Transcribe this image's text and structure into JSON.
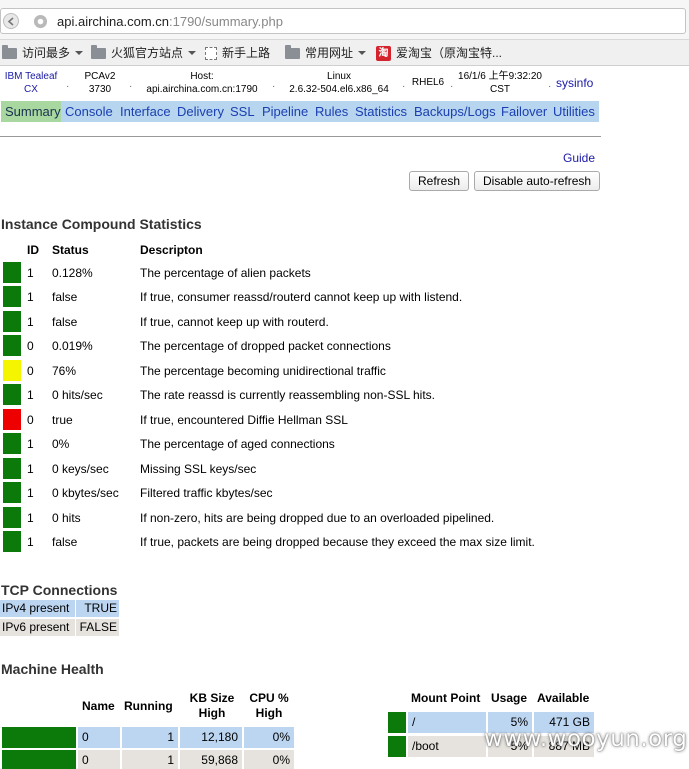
{
  "browser": {
    "url_host": "api.airchina.com.cn",
    "url_rest": ":1790/summary.php",
    "bookmarks": [
      {
        "label": "访问最多",
        "icon": "folder-icon",
        "dropdown": true
      },
      {
        "label": "火狐官方站点",
        "icon": "folder-icon",
        "dropdown": true
      },
      {
        "label": "新手上路",
        "icon": "page-icon",
        "dropdown": false
      },
      {
        "label": "常用网址",
        "icon": "folder-icon",
        "dropdown": true
      },
      {
        "label": "爱淘宝（原淘宝特...",
        "icon": "taobao-icon",
        "dropdown": false
      }
    ],
    "taobao_glyph": "淘"
  },
  "header": {
    "product_line1": "IBM Tealeaf",
    "product_line2": "CX",
    "version_line1": "PCAv2",
    "version_line2": "3730",
    "host_label": "Host:",
    "host_value": "api.airchina.com.cn:1790",
    "os_line1": "Linux",
    "os_line2": "2.6.32-504.el6.x86_64",
    "distro": "RHEL6",
    "time_line1": "16/1/6 上午9:32:20",
    "time_line2": "CST",
    "sysinfo": "sysinfo",
    "separator": "·"
  },
  "tabs": [
    "Summary",
    "Console",
    "Interface",
    "Delivery",
    "SSL",
    "Pipeline",
    "Rules",
    "Statistics",
    "Backups/Logs",
    "Failover",
    "Utilities"
  ],
  "active_tab": "Summary",
  "toolbar": {
    "guide": "Guide",
    "refresh": "Refresh",
    "disable_refresh": "Disable auto-refresh"
  },
  "instance_stats": {
    "title": "Instance Compound Statistics",
    "columns": [
      "ID",
      "Status",
      "Descripton"
    ],
    "rows": [
      {
        "light": "#0b7a0b",
        "id": "1",
        "status": "0.128%",
        "desc": "The percentage of alien packets"
      },
      {
        "light": "#0b7a0b",
        "id": "1",
        "status": "false",
        "desc": "If true, consumer reassd/routerd cannot keep up with listend."
      },
      {
        "light": "#0b7a0b",
        "id": "1",
        "status": "false",
        "desc": "If true, cannot keep up with routerd."
      },
      {
        "light": "#0b7a0b",
        "id": "0",
        "status": "0.019%",
        "desc": "The percentage of dropped packet connections"
      },
      {
        "light": "#f5f500",
        "id": "0",
        "status": "76%",
        "desc": "The percentage becoming unidirectional traffic"
      },
      {
        "light": "#0b7a0b",
        "id": "1",
        "status": "0 hits/sec",
        "desc": "The rate reassd is currently reassembling non-SSL hits."
      },
      {
        "light": "#ee0000",
        "id": "0",
        "status": "true",
        "desc": "If true, encountered Diffie Hellman SSL"
      },
      {
        "light": "#0b7a0b",
        "id": "1",
        "status": "0%",
        "desc": "The percentage of aged connections"
      },
      {
        "light": "#0b7a0b",
        "id": "1",
        "status": "0 keys/sec",
        "desc": "Missing SSL keys/sec"
      },
      {
        "light": "#0b7a0b",
        "id": "1",
        "status": "0 kbytes/sec",
        "desc": "Filtered traffic kbytes/sec"
      },
      {
        "light": "#0b7a0b",
        "id": "1",
        "status": "0 hits",
        "desc": "If non-zero, hits are being dropped due to an overloaded pipelined."
      },
      {
        "light": "#0b7a0b",
        "id": "1",
        "status": "false",
        "desc": "If true, packets are being dropped because they exceed the max size limit."
      }
    ]
  },
  "tcp": {
    "title": "TCP Connections",
    "rows": [
      {
        "label": "IPv4 present",
        "value": "TRUE"
      },
      {
        "label": "IPv6 present",
        "value": "FALSE"
      }
    ]
  },
  "machine_health": {
    "title": "Machine Health",
    "proc_headers": {
      "name": "Name",
      "running": "Running",
      "kb1": "KB Size",
      "kb2": "High",
      "cpu1": "CPU %",
      "cpu2": "High"
    },
    "proc_rows": [
      {
        "name": "0",
        "running": "1",
        "kb": "12,180",
        "cpu": "0%"
      },
      {
        "name": "0",
        "running": "1",
        "kb": "59,868",
        "cpu": "0%"
      }
    ],
    "mount_headers": {
      "mount": "Mount Point",
      "usage": "Usage",
      "available": "Available"
    },
    "mount_rows": [
      {
        "mount": "/",
        "usage": "5%",
        "available": "471 GB"
      },
      {
        "mount": "/boot",
        "usage": "5%",
        "available": "887 MB"
      }
    ]
  },
  "watermark": "www.wooyun.org",
  "colors": {
    "ok": "#0b7a0b",
    "warn": "#f5f500",
    "error": "#ee0000",
    "tab": "#b7d5ef",
    "tab_active": "#a8d8a0"
  }
}
